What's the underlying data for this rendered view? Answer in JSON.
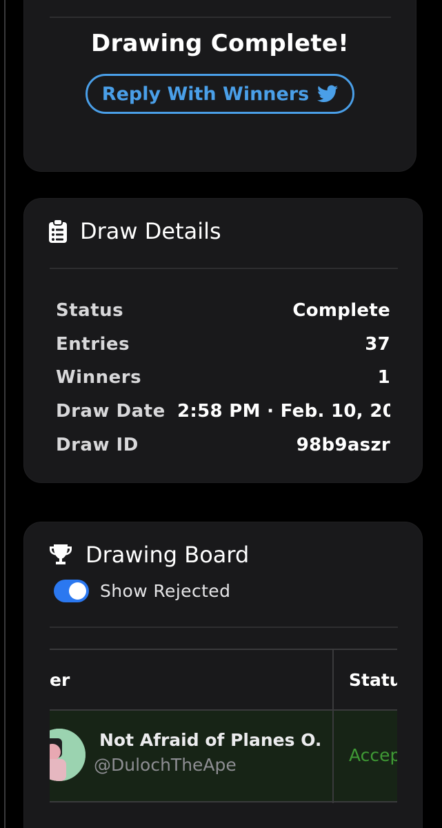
{
  "result": {
    "title": "Drawing Complete!",
    "reply_button": "Reply With Winners",
    "reply_icon": "twitter-bird-icon",
    "accent": "#4a9fe8"
  },
  "details": {
    "heading": "Draw Details",
    "icon": "clipboard-list-icon",
    "rows": [
      {
        "label": "Status",
        "value": "Complete"
      },
      {
        "label": "Entries",
        "value": "37"
      },
      {
        "label": "Winners",
        "value": "1"
      },
      {
        "label": "Draw Date",
        "value": "2:58 PM · Feb. 10, 202"
      },
      {
        "label": "Draw ID",
        "value": "98b9aszr"
      }
    ]
  },
  "board": {
    "heading": "Drawing Board",
    "icon": "trophy-icon",
    "toggle": {
      "label": "Show Rejected",
      "on": true,
      "color": "#2b78f0"
    },
    "table": {
      "headers": [
        "er",
        "Statu"
      ],
      "rows": [
        {
          "name": "Not Afraid of Planes O...",
          "handle": "@DulochTheApe",
          "status": "Accep",
          "status_color": "#3f9a35"
        }
      ]
    }
  }
}
